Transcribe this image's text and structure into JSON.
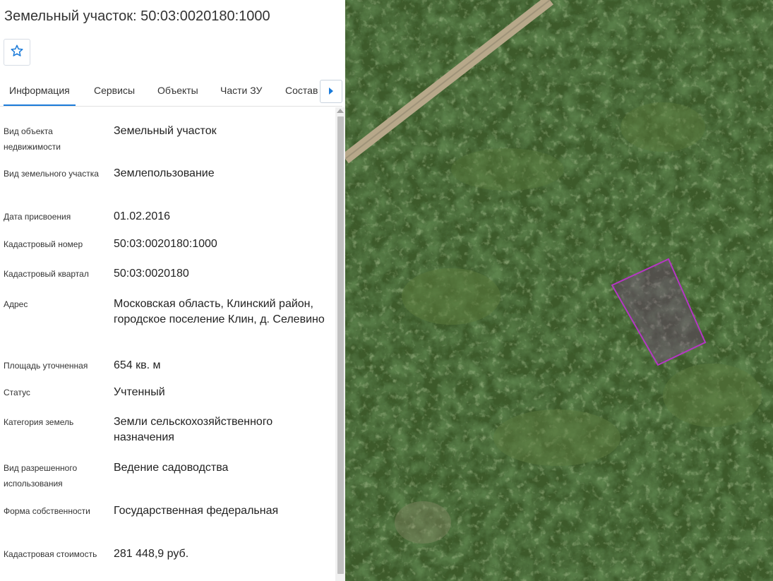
{
  "panel": {
    "title": "Земельный участок: 50:03:0020180:1000",
    "favorite_icon": "star-outline-icon",
    "tabs": [
      {
        "label": "Информация",
        "active": true
      },
      {
        "label": "Сервисы",
        "active": false
      },
      {
        "label": "Объекты",
        "active": false
      },
      {
        "label": "Части ЗУ",
        "active": false
      },
      {
        "label": "Состав",
        "active": false
      }
    ],
    "tabs_next_icon": "caret-right-icon",
    "accent_color": "#1a7ad9",
    "fields": [
      {
        "label": "Вид объекта недвижимости",
        "value": "Земельный участок"
      },
      {
        "label": "Вид земельного участка",
        "value": "Землепользование"
      },
      {
        "label": "Дата присвоения",
        "value": "01.02.2016"
      },
      {
        "label": "Кадастровый номер",
        "value": "50:03:0020180:1000"
      },
      {
        "label": "Кадастровый квартал",
        "value": "50:03:0020180"
      },
      {
        "label": "Адрес",
        "value": "Московская область, Клинский район, городское поселение Клин, д. Селевино"
      },
      {
        "label": "Площадь уточненная",
        "value": "654 кв. м"
      },
      {
        "label": "Статус",
        "value": "Учтенный"
      },
      {
        "label": "Категория земель",
        "value": "Земли сельскохозяйственного назначения"
      },
      {
        "label": "Вид разрешенного использования",
        "value": "Ведение садоводства"
      },
      {
        "label": "Форма собственности",
        "value": "Государственная федеральная"
      },
      {
        "label": "Кадастровая стоимость",
        "value": "281 448,9 руб."
      }
    ]
  },
  "map": {
    "parcel_outline_color": "#b536c4",
    "forest_color": "#3c5a2a",
    "road_color": "#b7a88a"
  }
}
